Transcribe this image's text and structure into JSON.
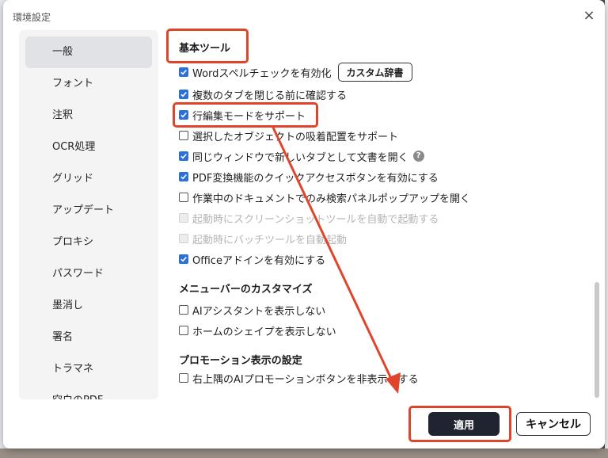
{
  "dialog": {
    "title": "環境設定",
    "close_glyph": "×"
  },
  "sidebar": {
    "items": [
      {
        "label": "一般"
      },
      {
        "label": "フォント"
      },
      {
        "label": "注釈"
      },
      {
        "label": "OCR処理"
      },
      {
        "label": "グリッド"
      },
      {
        "label": "アップデート"
      },
      {
        "label": "プロキシ"
      },
      {
        "label": "パスワード"
      },
      {
        "label": "墨消し"
      },
      {
        "label": "署名"
      },
      {
        "label": "トラマネ"
      },
      {
        "label": "空白のPDF"
      }
    ]
  },
  "basic_tools": {
    "heading": "基本ツール",
    "options": [
      {
        "label": "Wordスペルチェックを有効化",
        "checked": true,
        "enabled": true
      },
      {
        "label": "複数のタブを閉じる前に確認する",
        "checked": true,
        "enabled": true
      },
      {
        "label": "行編集モードをサポート",
        "checked": true,
        "enabled": true
      },
      {
        "label": "選択したオブジェクトの吸着配置をサポート",
        "checked": false,
        "enabled": true
      },
      {
        "label": "同じウィンドウで新しいタブとして文書を開く",
        "checked": true,
        "enabled": true
      },
      {
        "label": "PDF変換機能のクイックアクセスボタンを有効にする",
        "checked": true,
        "enabled": true
      },
      {
        "label": "作業中のドキュメントでのみ検索パネルポップアップを開く",
        "checked": false,
        "enabled": true
      },
      {
        "label": "起動時にスクリーンショットツールを自動で起動する",
        "checked": false,
        "enabled": false
      },
      {
        "label": "起動時にバッチツールを自動起動",
        "checked": false,
        "enabled": false
      },
      {
        "label": "Officeアドインを有効にする",
        "checked": true,
        "enabled": true
      }
    ],
    "custom_dict_button": "カスタム辞書",
    "help_glyph": "?"
  },
  "menubar_custom": {
    "heading": "メニューバーのカスタマイズ",
    "options": [
      {
        "label": "AIアシスタントを表示しない",
        "checked": false,
        "enabled": true
      },
      {
        "label": "ホームのシェイプを表示しない",
        "checked": false,
        "enabled": true
      }
    ]
  },
  "promotion": {
    "heading": "プロモーション表示の設定",
    "options": [
      {
        "label": "右上隅のAIプロモーションボタンを非表示にする",
        "checked": false,
        "enabled": true
      }
    ]
  },
  "footer": {
    "apply_label": "適用",
    "cancel_label": "キャンセル"
  },
  "colors": {
    "accent_checkbox": "#2a6fdb",
    "annotation_red": "#e0452c",
    "apply_bg": "#1f2430"
  }
}
